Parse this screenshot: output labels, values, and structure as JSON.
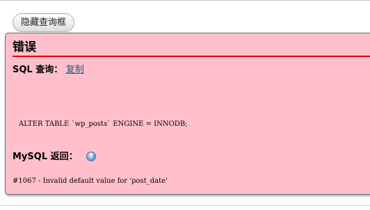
{
  "toggle_button": {
    "label": "隐藏查询框"
  },
  "error_panel": {
    "heading": "错误",
    "sql_query_label": "SQL 查询：",
    "copy_link": "复制",
    "sql_code": "ALTER TABLE `wp_posts` ENGINE = INNODB;",
    "mysql_return_label": "MySQL 返回：",
    "help_icon": "help-icon",
    "help_glyph": "?",
    "error_message": "#1067 - Invalid default value for 'post_date'"
  },
  "colors": {
    "error_background": "#ffc0cb",
    "heading_rule": "#e00000",
    "link": "#235a81"
  }
}
